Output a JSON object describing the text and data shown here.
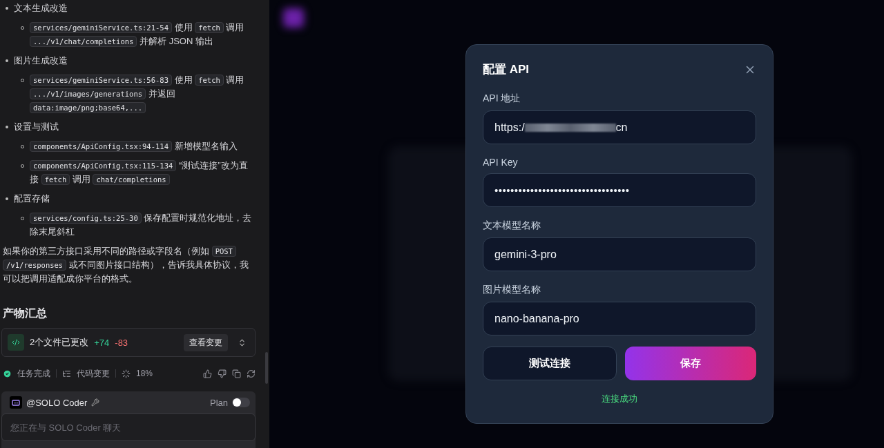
{
  "chat_log": {
    "items": [
      {
        "kind": "bullet",
        "segments": [
          {
            "kind": "text",
            "text": "文本生成改造"
          }
        ]
      },
      {
        "kind": "sub",
        "segments": [
          {
            "kind": "code",
            "text": "services/geminiService.ts:21-54"
          },
          {
            "kind": "text",
            "text": " 使用 "
          },
          {
            "kind": "code",
            "text": "fetch"
          },
          {
            "kind": "text",
            "text": " 调用 "
          },
          {
            "kind": "code",
            "text": ".../v1/chat/completions"
          },
          {
            "kind": "text",
            "text": " 并解析 JSON 输出"
          }
        ]
      },
      {
        "kind": "bullet",
        "segments": [
          {
            "kind": "text",
            "text": "图片生成改造"
          }
        ]
      },
      {
        "kind": "sub",
        "segments": [
          {
            "kind": "code",
            "text": "services/geminiService.ts:56-83"
          },
          {
            "kind": "text",
            "text": " 使用 "
          },
          {
            "kind": "code",
            "text": "fetch"
          },
          {
            "kind": "text",
            "text": " 调用 "
          },
          {
            "kind": "code",
            "text": ".../v1/images/generations"
          },
          {
            "kind": "text",
            "text": " 并返回 "
          },
          {
            "kind": "code",
            "text": "data:image/png;base64,..."
          }
        ]
      },
      {
        "kind": "bullet",
        "segments": [
          {
            "kind": "text",
            "text": "设置与测试"
          }
        ]
      },
      {
        "kind": "sub",
        "segments": [
          {
            "kind": "code",
            "text": "components/ApiConfig.tsx:94-114"
          },
          {
            "kind": "text",
            "text": " 新增模型名输入"
          }
        ]
      },
      {
        "kind": "sub",
        "segments": [
          {
            "kind": "code",
            "text": "components/ApiConfig.tsx:115-134"
          },
          {
            "kind": "text",
            "text": " “测试连接”改为直接 "
          },
          {
            "kind": "code",
            "text": "fetch"
          },
          {
            "kind": "text",
            "text": " 调用 "
          },
          {
            "kind": "code",
            "text": "chat/completions"
          }
        ]
      },
      {
        "kind": "bullet",
        "segments": [
          {
            "kind": "text",
            "text": "配置存储"
          }
        ]
      },
      {
        "kind": "sub",
        "segments": [
          {
            "kind": "code",
            "text": "services/config.ts:25-30"
          },
          {
            "kind": "text",
            "text": " 保存配置时规范化地址，去除末尾斜杠"
          }
        ]
      },
      {
        "kind": "para",
        "segments": [
          {
            "kind": "text",
            "text": "如果你的第三方接口采用不同的路径或字段名（例如 "
          },
          {
            "kind": "code",
            "text": "POST /v1/responses"
          },
          {
            "kind": "text",
            "text": " 或不同图片接口结构），告诉我具体协议，我可以把调用适配成你平台的格式。"
          }
        ]
      }
    ]
  },
  "summary": {
    "title": "产物汇总",
    "files_label": "2个文件已更改",
    "added": "+74",
    "removed": "-83",
    "view_button": "查看变更"
  },
  "status_row": {
    "done": "任务完成",
    "code_changes": "代码变更",
    "progress": "18%"
  },
  "chat": {
    "agent": "@SOLO Coder",
    "plan_label": "Plan",
    "plan_on": false,
    "placeholder": "您正在与 SOLO Coder 聊天"
  },
  "dialog": {
    "title": "配置 API",
    "fields": [
      {
        "label": "API 地址",
        "value_start": "https:/",
        "value_end": "cn",
        "redacted": true
      },
      {
        "label": "API Key",
        "value": "••••••••••••••••••••••••••••••••••",
        "masked": true
      },
      {
        "label": "文本模型名称",
        "value": "gemini-3-pro"
      },
      {
        "label": "图片模型名称",
        "value": "nano-banana-pro"
      }
    ],
    "buttons": [
      {
        "label": "测试连接",
        "kind": "secondary"
      },
      {
        "label": "保存",
        "kind": "primary"
      }
    ],
    "status": "连接成功"
  }
}
